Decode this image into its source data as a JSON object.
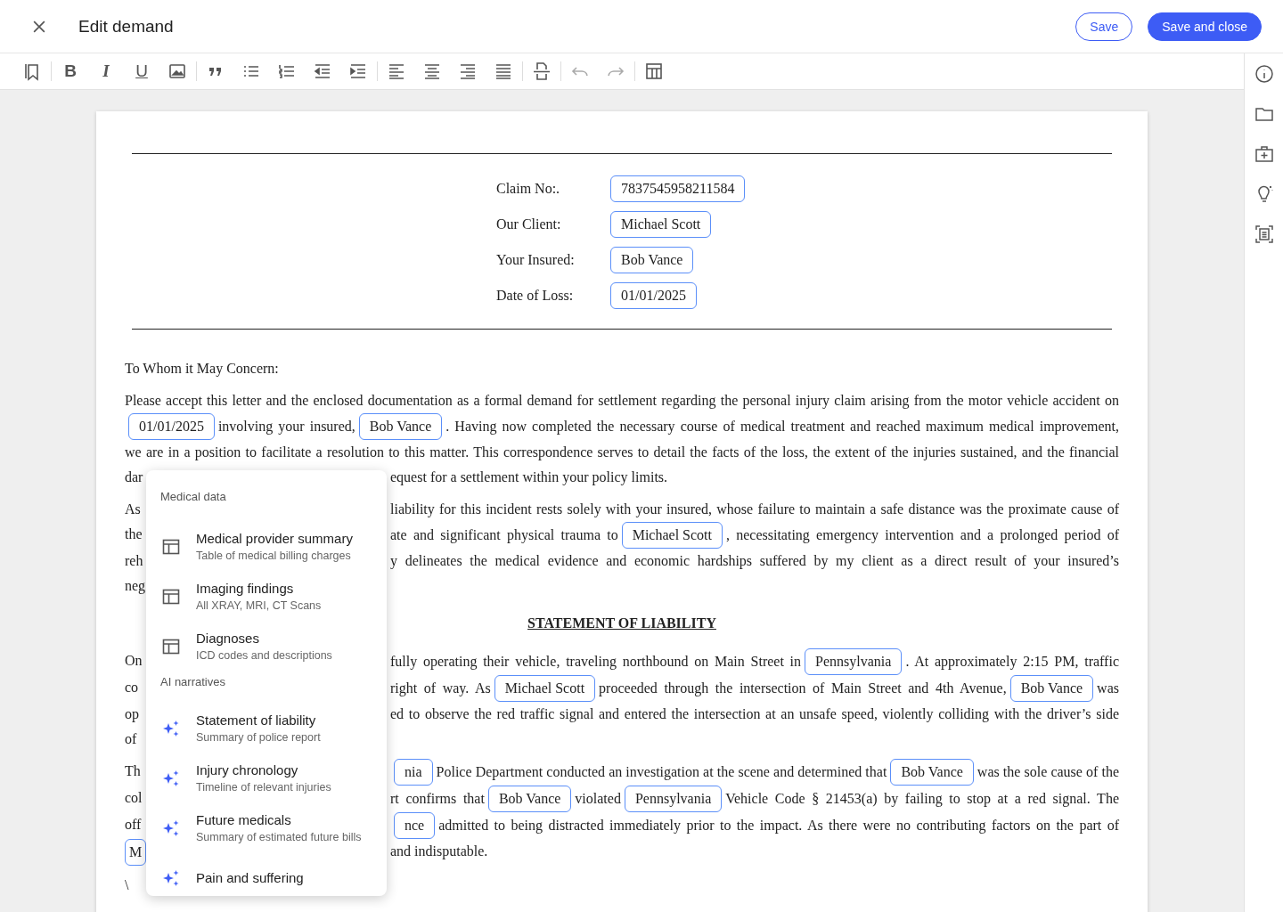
{
  "header": {
    "title": "Edit demand",
    "buttons": [
      {
        "label": "Save",
        "kind": "outline"
      },
      {
        "label": "Save and close",
        "kind": "primary"
      }
    ]
  },
  "toolbar": {
    "bold": "B",
    "italic": "I",
    "underline": "U",
    "undo": {
      "disabled": true
    },
    "redo": {
      "disabled": true
    }
  },
  "letterhead": [
    {
      "label": "Claim No:.",
      "value": "7837545958211584"
    },
    {
      "label": "Our Client:",
      "value": "Michael Scott"
    },
    {
      "label": "Your Insured:",
      "value": "Bob Vance"
    },
    {
      "label": "Date of Loss:",
      "value": "01/01/2025"
    }
  ],
  "body": [
    {
      "kind": "paragraph",
      "lines": [
        {
          "segments": [
            {
              "kind": "text",
              "text": "To Whom it May Concern:"
            }
          ]
        }
      ]
    },
    {
      "kind": "paragraph",
      "lines": [
        {
          "segments": [
            {
              "kind": "text",
              "text": "Please accept this letter and the enclosed documentation as a formal demand for settlement regarding the personal injury claim arising from the motor vehicle accident on"
            }
          ]
        },
        {
          "segments": [
            {
              "kind": "chip",
              "text": "01/01/2025"
            },
            {
              "kind": "text",
              "text": "involving your insured,"
            },
            {
              "kind": "chip",
              "text": "Bob Vance"
            },
            {
              "kind": "text",
              "text": ". Having now completed the necessary course of medical treatment and reached maximum medical improvement,"
            }
          ]
        },
        {
          "segments": [
            {
              "kind": "text",
              "text": "we are in a position to facilitate a resolution to this matter. This correspondence serves to detail the facts of the loss, the extent of the injuries sustained, and the financial"
            }
          ]
        },
        {
          "left": {
            "kind": "text",
            "text": "dar"
          },
          "segments": [
            {
              "kind": "text",
              "text": "equest for a settlement within your policy limits."
            }
          ]
        }
      ]
    },
    {
      "kind": "paragraph",
      "lines": [
        {
          "left": {
            "kind": "text",
            "text": "As"
          },
          "segments": [
            {
              "kind": "text",
              "text": "liability for this incident rests solely with your insured, whose failure to maintain a safe distance was the proximate cause of"
            }
          ]
        },
        {
          "left": {
            "kind": "text",
            "text": "the"
          },
          "segments": [
            {
              "kind": "text",
              "text": "ate and significant physical trauma to"
            },
            {
              "kind": "chip",
              "text": "Michael Scott"
            },
            {
              "kind": "text",
              "text": ", necessitating emergency intervention and a prolonged period of"
            }
          ]
        },
        {
          "left": {
            "kind": "text",
            "text": "reh"
          },
          "segments": [
            {
              "kind": "text",
              "text": "y delineates the medical evidence and economic hardships suffered by my client as a direct result of your insured’s"
            }
          ]
        },
        {
          "left": {
            "kind": "text",
            "text": "neg"
          }
        }
      ]
    },
    {
      "kind": "heading",
      "text": "STATEMENT OF LIABILITY"
    },
    {
      "kind": "paragraph",
      "lines": [
        {
          "left": {
            "kind": "text",
            "text": "On"
          },
          "segments": [
            {
              "kind": "text",
              "text": "fully operating their vehicle, traveling northbound on Main Street in"
            },
            {
              "kind": "chip",
              "text": "Pennsylvania"
            },
            {
              "kind": "text",
              "text": ". At approximately 2:15 PM, traffic"
            }
          ]
        },
        {
          "left": {
            "kind": "text",
            "text": "co"
          },
          "segments": [
            {
              "kind": "text",
              "text": "right of way. As"
            },
            {
              "kind": "chip",
              "text": "Michael Scott"
            },
            {
              "kind": "text",
              "text": "proceeded through the intersection of Main Street and 4th Avenue,"
            },
            {
              "kind": "chip",
              "text": "Bob Vance"
            },
            {
              "kind": "text",
              "text": "was"
            }
          ]
        },
        {
          "left": {
            "kind": "text",
            "text": "op"
          },
          "segments": [
            {
              "kind": "text",
              "text": "ed to observe the red traffic signal and entered the intersection at an unsafe speed, violently colliding with the driver’s side"
            }
          ]
        },
        {
          "left": {
            "kind": "text",
            "text": "of"
          }
        }
      ]
    },
    {
      "kind": "paragraph",
      "lines": [
        {
          "left": {
            "kind": "text",
            "text": "Th"
          },
          "segments": [
            {
              "kind": "chip",
              "text": "nia"
            },
            {
              "kind": "text",
              "text": "Police Department conducted an investigation at the scene and determined that"
            },
            {
              "kind": "chip",
              "text": "Bob Vance"
            },
            {
              "kind": "text",
              "text": "was the sole cause of the"
            }
          ]
        },
        {
          "left": {
            "kind": "text",
            "text": "col"
          },
          "segments": [
            {
              "kind": "text",
              "text": "rt confirms that"
            },
            {
              "kind": "chip",
              "text": "Bob Vance"
            },
            {
              "kind": "text",
              "text": "violated"
            },
            {
              "kind": "chip",
              "text": "Pennsylvania"
            },
            {
              "kind": "text",
              "text": "Vehicle Code § 21453(a) by failing to stop at a red signal. The"
            }
          ]
        },
        {
          "left": {
            "kind": "text",
            "text": "off"
          },
          "segments": [
            {
              "kind": "chip",
              "text": "nce"
            },
            {
              "kind": "text",
              "text": "admitted to being distracted immediately prior to the impact. As there were no contributing factors on the part of"
            }
          ]
        },
        {
          "left": {
            "kind": "chip",
            "text": "M"
          },
          "segments": [
            {
              "kind": "text",
              "text": "and indisputable."
            }
          ]
        }
      ]
    },
    {
      "kind": "paragraph",
      "lines": [
        {
          "segments": [
            {
              "kind": "text",
              "text": "\\"
            }
          ]
        }
      ]
    }
  ],
  "menu": [
    {
      "title": "Medical data",
      "items": [
        {
          "kind": "table",
          "title": "Medical provider summary",
          "subtitle": "Table of medical billing charges"
        },
        {
          "kind": "table",
          "title": "Imaging findings",
          "subtitle": "All XRAY, MRI, CT Scans"
        },
        {
          "kind": "table",
          "title": "Diagnoses",
          "subtitle": "ICD codes and descriptions"
        }
      ]
    },
    {
      "title": "AI narratives",
      "items": [
        {
          "kind": "ai",
          "title": "Statement of liability",
          "subtitle": "Summary of police report"
        },
        {
          "kind": "ai",
          "title": "Injury chronology",
          "subtitle": "Timeline of relevant injuries"
        },
        {
          "kind": "ai",
          "title": "Future medicals",
          "subtitle": "Summary of estimated future bills"
        },
        {
          "kind": "ai",
          "title": "Pain and suffering"
        }
      ]
    }
  ]
}
